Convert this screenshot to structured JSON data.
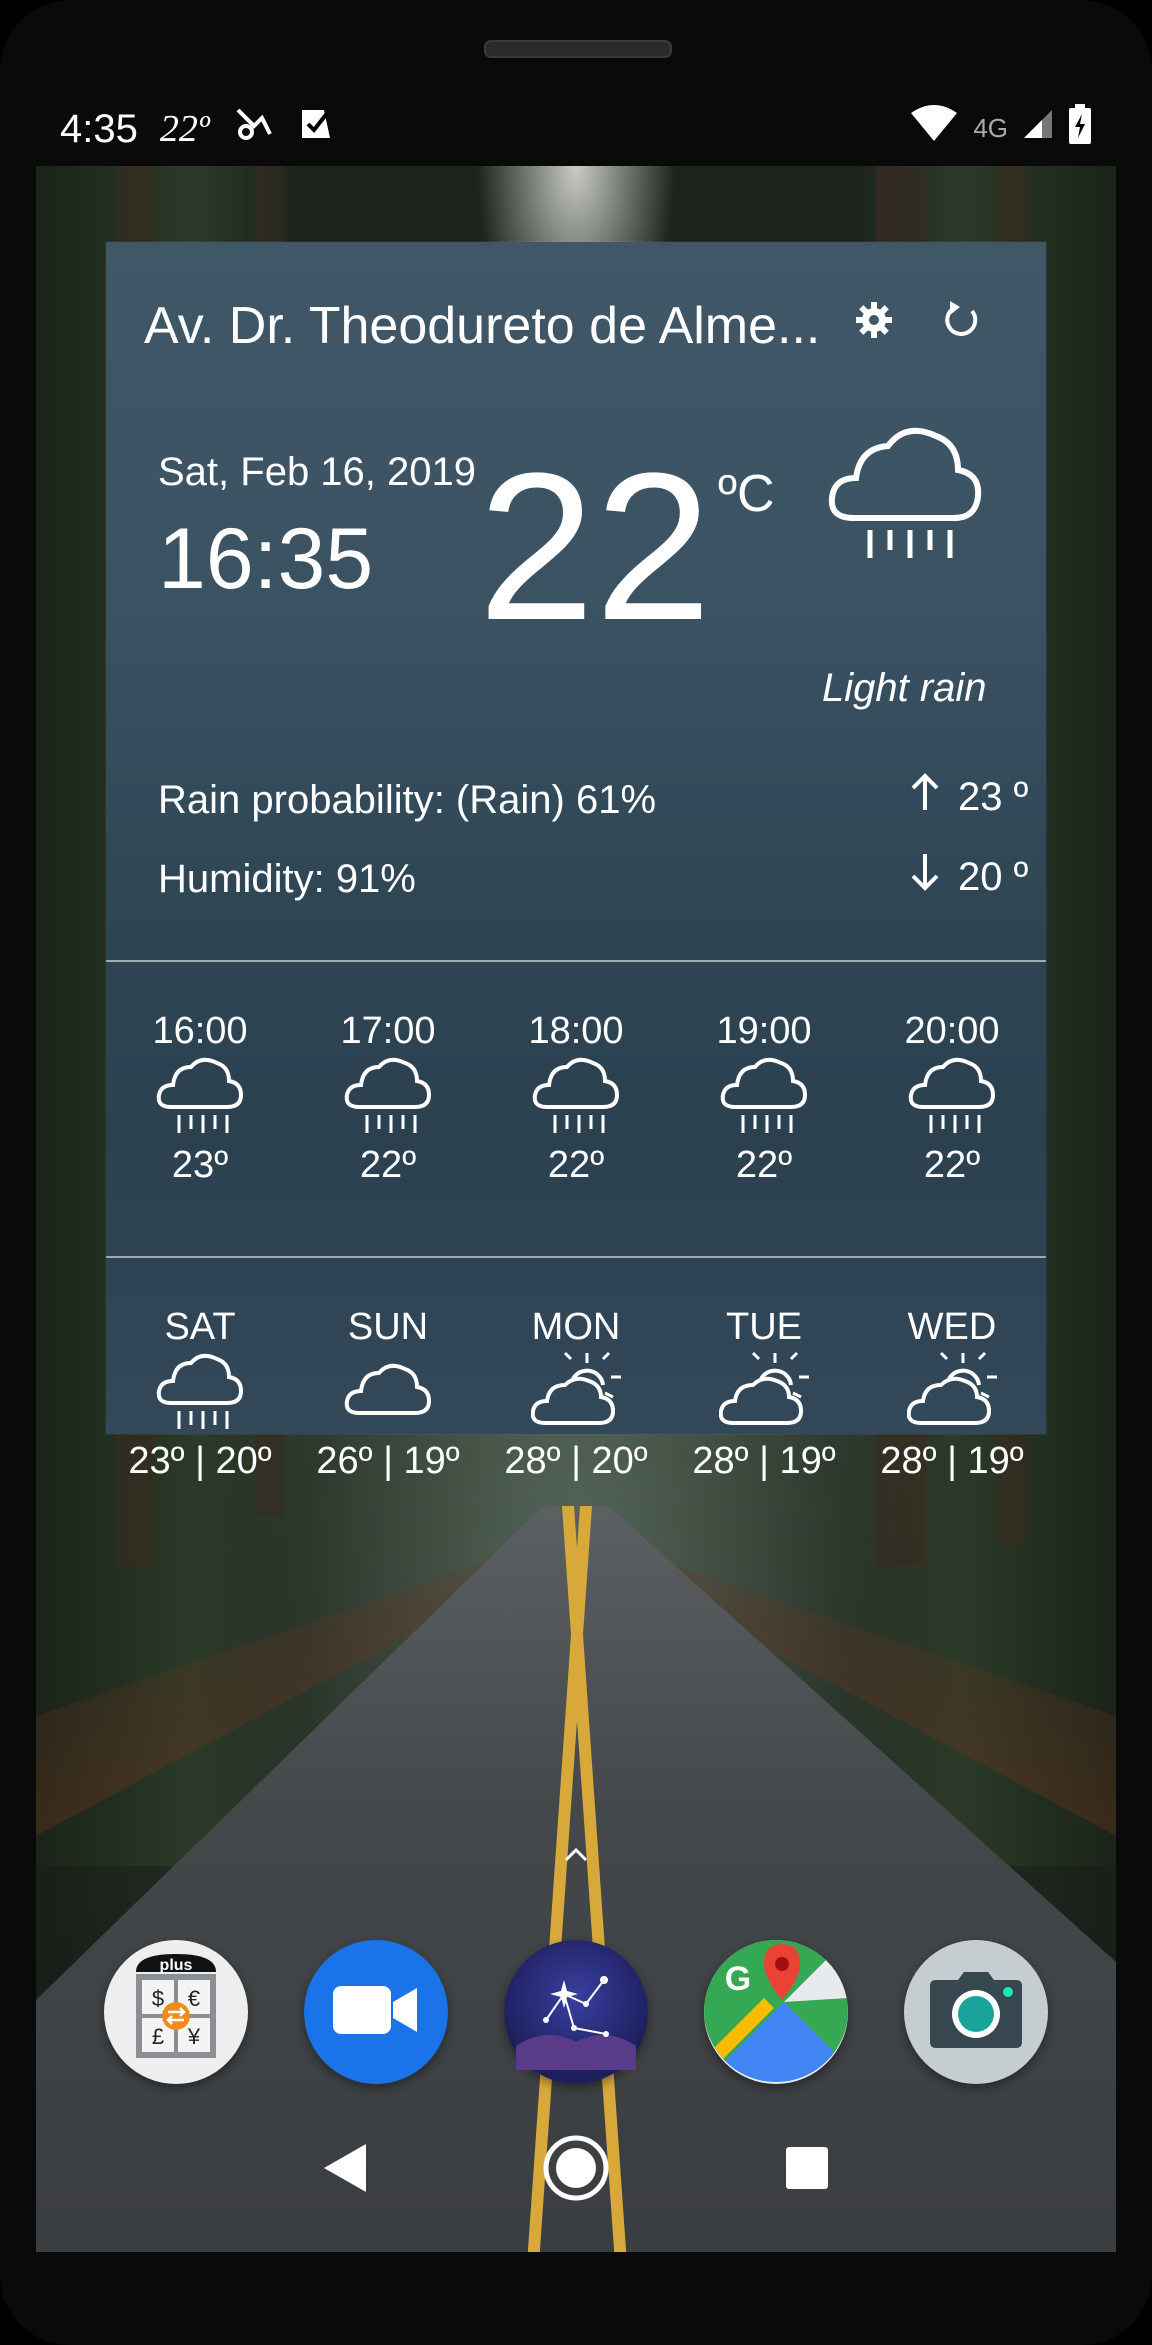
{
  "status_bar": {
    "time": "4:35",
    "temp": "22º",
    "network": "4G"
  },
  "widget": {
    "location": "Av. Dr. Theodureto de Alme...",
    "date": "Sat, Feb 16, 2019",
    "clock": "16:35",
    "temperature": "22",
    "unit": "ºC",
    "condition": "Light rain",
    "rain_probability": "Rain probability: (Rain) 61%",
    "humidity": "Humidity: 91%",
    "high": "23 º",
    "low": "20 º",
    "icons": {
      "settings": "gear-icon",
      "refresh": "refresh-icon",
      "current": "cloud-rain-icon"
    }
  },
  "hourly": [
    {
      "time": "16:00",
      "temp": "23º",
      "icon": "cloud-rain-icon"
    },
    {
      "time": "17:00",
      "temp": "22º",
      "icon": "cloud-rain-icon"
    },
    {
      "time": "18:00",
      "temp": "22º",
      "icon": "cloud-rain-icon"
    },
    {
      "time": "19:00",
      "temp": "22º",
      "icon": "cloud-rain-icon"
    },
    {
      "time": "20:00",
      "temp": "22º",
      "icon": "cloud-rain-icon"
    }
  ],
  "daily": [
    {
      "day": "SAT",
      "temps": "23º | 20º",
      "icon": "cloud-rain-icon"
    },
    {
      "day": "SUN",
      "temps": "26º | 19º",
      "icon": "cloud-icon"
    },
    {
      "day": "MON",
      "temps": "28º | 20º",
      "icon": "partly-sunny-icon"
    },
    {
      "day": "TUE",
      "temps": "28º | 19º",
      "icon": "partly-sunny-icon"
    },
    {
      "day": "WED",
      "temps": "28º | 19º",
      "icon": "partly-sunny-icon"
    }
  ],
  "dock": {
    "apps": [
      "currency-converter-plus",
      "video-call",
      "star-map",
      "maps",
      "camera"
    ],
    "plus_label": "plus"
  }
}
